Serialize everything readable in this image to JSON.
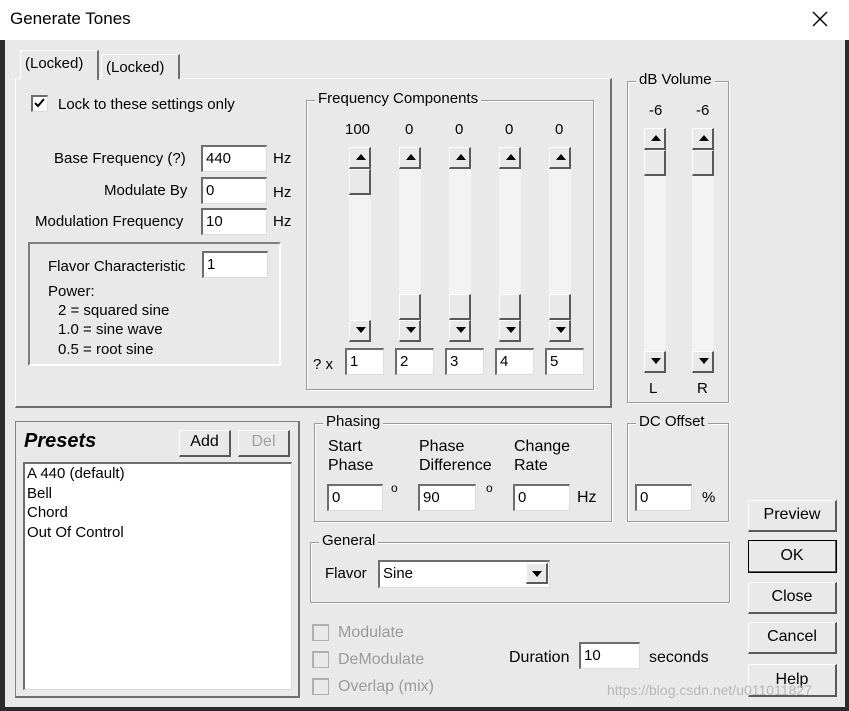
{
  "window": {
    "title": "Generate Tones"
  },
  "tabs": [
    {
      "label": "(Locked)"
    },
    {
      "label": "(Locked)"
    }
  ],
  "lock_checkbox": {
    "label": "Lock to these settings only",
    "checked": true
  },
  "base_frequency": {
    "label": "Base Frequency (?)",
    "value": "440",
    "unit": "Hz"
  },
  "modulate_by": {
    "label": "Modulate By",
    "value": "0",
    "unit": "Hz"
  },
  "modulation_frequency": {
    "label": "Modulation Frequency",
    "value": "10",
    "unit": "Hz"
  },
  "flavor_box": {
    "label": "Flavor Characteristic",
    "value": "1",
    "power_title": "Power:",
    "lines": [
      "2 = squared sine",
      "1.0 = sine wave",
      "0.5 = root sine"
    ]
  },
  "frequency_components": {
    "title": "Frequency Components",
    "levels": [
      "100",
      "0",
      "0",
      "0",
      "0"
    ],
    "level_fractions": [
      1.0,
      0,
      0,
      0,
      0
    ],
    "multiplier_label": "? x",
    "multipliers": [
      "1",
      "2",
      "3",
      "4",
      "5"
    ]
  },
  "db_volume": {
    "title": "dB Volume",
    "left_value": "-6",
    "right_value": "-6",
    "left_label": "L",
    "right_label": "R"
  },
  "presets": {
    "title": "Presets",
    "add_label": "Add",
    "del_label": "Del",
    "items": [
      "A 440 (default)",
      "Bell",
      "Chord",
      "Out Of Control"
    ]
  },
  "phasing": {
    "title": "Phasing",
    "start_phase_label_1": "Start",
    "start_phase_label_2": "Phase",
    "start_phase_value": "0",
    "phase_diff_label_1": "Phase",
    "phase_diff_label_2": "Difference",
    "phase_diff_value": "90",
    "change_rate_label_1": "Change",
    "change_rate_label_2": "Rate",
    "change_rate_value": "0",
    "degree_symbol": "o",
    "rate_unit": "Hz"
  },
  "dc_offset": {
    "title": "DC Offset",
    "value": "0",
    "unit": "%"
  },
  "general": {
    "title": "General",
    "flavor_label": "Flavor",
    "flavor_value": "Sine"
  },
  "options": {
    "modulate_label": "Modulate",
    "demodulate_label": "DeModulate",
    "overlap_label": "Overlap (mix)"
  },
  "duration": {
    "label": "Duration",
    "value": "10",
    "unit": "seconds"
  },
  "buttons": {
    "preview": "Preview",
    "ok": "OK",
    "close": "Close",
    "cancel": "Cancel",
    "help": "Help"
  },
  "watermark": "https://blog.csdn.net/u011011827"
}
